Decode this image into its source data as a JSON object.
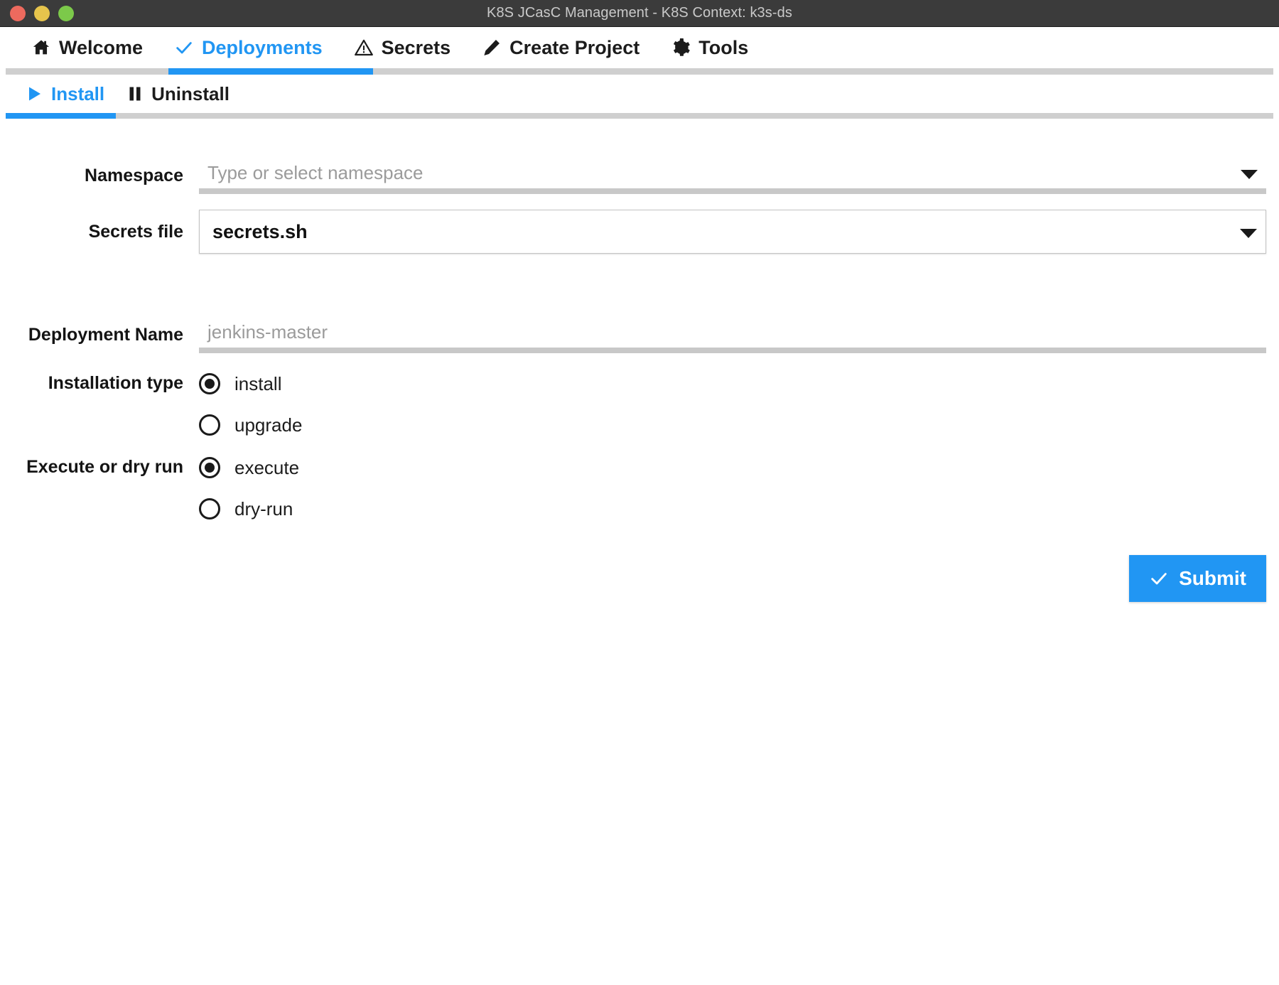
{
  "window": {
    "title": "K8S JCasC Management - K8S Context: k3s-ds",
    "controls": {
      "close_label": "close-button",
      "minimize_label": "minimize-button",
      "zoom_label": "zoom-button"
    },
    "colors": {
      "titlebar_bg": "#3b3b3b",
      "title_text": "#c9c9c9",
      "close": "#ed6a5e",
      "minimize": "#e6c44c",
      "maximize": "#7cc94a",
      "accent": "#2196f3",
      "track": "#cfcfcf"
    }
  },
  "tabs": [
    {
      "label": "Welcome",
      "icon": "home-icon",
      "active": false
    },
    {
      "label": "Deployments",
      "icon": "check-icon",
      "active": true
    },
    {
      "label": "Secrets",
      "icon": "warning-icon",
      "active": false
    },
    {
      "label": "Create Project",
      "icon": "pencil-icon",
      "active": false
    },
    {
      "label": "Tools",
      "icon": "gear-icon",
      "active": false
    }
  ],
  "subtabs": [
    {
      "label": "Install",
      "icon": "play-icon",
      "active": true
    },
    {
      "label": "Uninstall",
      "icon": "pause-icon",
      "active": false
    }
  ],
  "form": {
    "namespace": {
      "label": "Namespace",
      "value": "",
      "placeholder": "Type or select namespace",
      "dropdown_icon": "chevron-down-icon"
    },
    "secrets_file": {
      "label": "Secrets file",
      "value": "secrets.sh",
      "dropdown_icon": "chevron-down-icon"
    },
    "deployment_name": {
      "label": "Deployment Name",
      "value": "",
      "placeholder": "jenkins-master"
    },
    "installation_type": {
      "label": "Installation type",
      "options": [
        {
          "label": "install",
          "checked": true
        },
        {
          "label": "upgrade",
          "checked": false
        }
      ]
    },
    "execute_or_dry_run": {
      "label": "Execute or dry run",
      "options": [
        {
          "label": "execute",
          "checked": true
        },
        {
          "label": "dry-run",
          "checked": false
        }
      ]
    },
    "submit": {
      "label": "Submit",
      "icon": "check-icon"
    }
  }
}
